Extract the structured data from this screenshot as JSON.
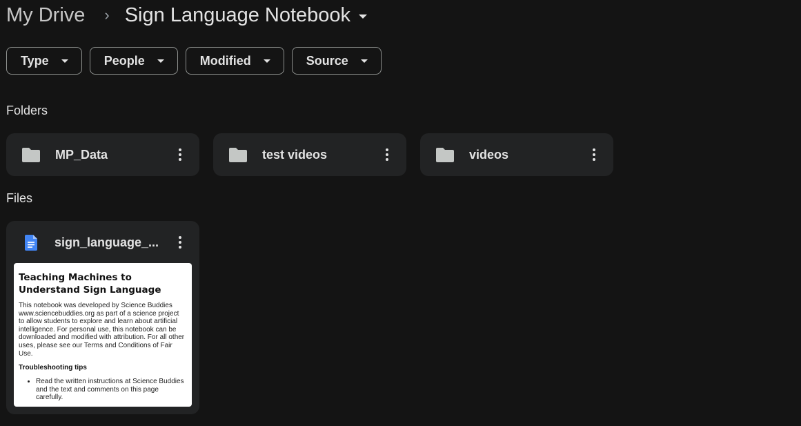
{
  "breadcrumb": {
    "root": "My Drive",
    "separator": "›",
    "current": "Sign Language Notebook"
  },
  "filters": [
    {
      "label": "Type"
    },
    {
      "label": "People"
    },
    {
      "label": "Modified"
    },
    {
      "label": "Source"
    }
  ],
  "sections": {
    "folders_label": "Folders",
    "files_label": "Files"
  },
  "folders": [
    {
      "name": "MP_Data",
      "icon": "folder-icon"
    },
    {
      "name": "test videos",
      "icon": "folder-icon"
    },
    {
      "name": "videos",
      "icon": "folder-icon"
    }
  ],
  "files": [
    {
      "name": "sign_language_...",
      "icon": "google-docs-icon",
      "preview": {
        "title": "Teaching Machines to Understand Sign Language",
        "body": "This notebook was developed by Science Buddies www.sciencebuddies.org as part of a science project to allow students to explore and learn about artificial intelligence. For personal use, this notebook can be downloaded and modified with attribution. For all other uses, please see our Terms and Conditions of Fair Use.",
        "subheading": "Troubleshooting tips",
        "bullet": "Read the written instructions at Science Buddies and the text and comments on this page carefully."
      }
    }
  ],
  "colors": {
    "background": "#141414",
    "card": "#222324",
    "text": "#e3e3e3",
    "chip_border": "#8e918f",
    "docs_blue": "#4285f4",
    "folder_grey": "#c4c7c5"
  }
}
